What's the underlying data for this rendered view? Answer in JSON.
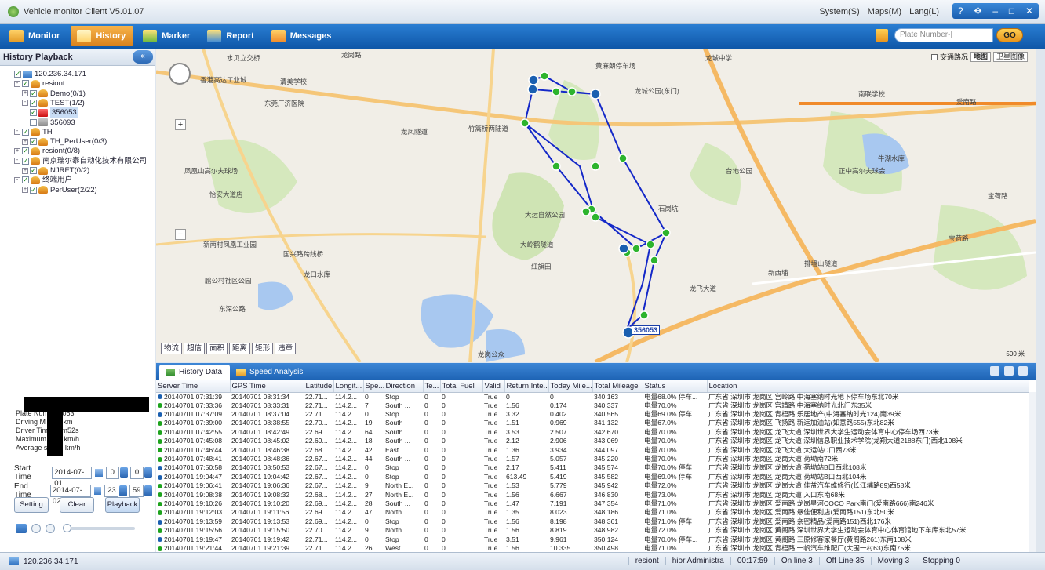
{
  "app": {
    "title": "Vehicle monitor Client V5.01.07",
    "menus": [
      "System(S)",
      "Maps(M)",
      "Lang(L)"
    ],
    "window_controls": [
      "?",
      "✥",
      "–",
      "□",
      "✕"
    ]
  },
  "toolbar": {
    "items": [
      {
        "label": "Monitor",
        "icon": "monitor-icon",
        "active": false
      },
      {
        "label": "History",
        "icon": "history-icon",
        "active": true
      },
      {
        "label": "Marker",
        "icon": "marker-icon",
        "active": false
      },
      {
        "label": "Report",
        "icon": "report-icon",
        "active": false
      },
      {
        "label": "Messages",
        "icon": "messages-icon",
        "active": false
      }
    ],
    "plate_placeholder": "Plate Number-|",
    "go_label": "GO"
  },
  "left": {
    "title": "History Playback",
    "close": "«",
    "tree": [
      {
        "label": "120.236.34.171",
        "icon": "pc",
        "checked": true,
        "exp": "",
        "level": 0
      },
      {
        "label": "resiont",
        "icon": "grp",
        "checked": true,
        "exp": "-",
        "level": 0
      },
      {
        "label": "Demo(0/1)",
        "icon": "grp",
        "checked": true,
        "exp": "+",
        "level": 1
      },
      {
        "label": "TEST(1/2)",
        "icon": "grp",
        "checked": true,
        "exp": "-",
        "level": 1
      },
      {
        "label": "356053",
        "icon": "car-on",
        "checked": true,
        "exp": "",
        "level": 2,
        "selected": true
      },
      {
        "label": "356093",
        "icon": "car-off",
        "checked": false,
        "exp": "",
        "level": 2
      },
      {
        "label": "TH",
        "icon": "grp",
        "checked": true,
        "exp": "-",
        "level": 0
      },
      {
        "label": "TH_PerUser(0/3)",
        "icon": "grp",
        "checked": true,
        "exp": "+",
        "level": 1
      },
      {
        "label": "resiont(0/8)",
        "icon": "grp",
        "checked": true,
        "exp": "+",
        "level": 0
      },
      {
        "label": "南京瑞尔泰自动化技术有限公司",
        "icon": "grp",
        "checked": true,
        "exp": "-",
        "level": 0
      },
      {
        "label": "NJRET(0/2)",
        "icon": "grp",
        "checked": true,
        "exp": "+",
        "level": 1
      },
      {
        "label": "终端用户",
        "icon": "grp",
        "checked": true,
        "exp": "-",
        "level": 0
      },
      {
        "label": "PerUser(2/22)",
        "icon": "grp",
        "checked": true,
        "exp": "+",
        "level": 1
      }
    ],
    "stats": [
      "Plate Num 356053",
      "Driving M 15.9 km",
      "Driver Tim 00hm52s",
      "Maximum 63.6 km/h",
      "Average s 18.1 km/h"
    ],
    "start_label": "Start Time",
    "start_date": "2014-07-01",
    "start_h": "0",
    "start_m": "0",
    "end_label": "End Time",
    "end_date": "2014-07-02",
    "end_h": "23",
    "end_m": "59",
    "buttons": [
      "Setting",
      "Clear",
      "Playback"
    ]
  },
  "map": {
    "traffic_label": "交通路况",
    "type_map": "地图",
    "type_sat": "卫星图像",
    "scale": "500 米",
    "marker_label": "356053",
    "tools": [
      "物流",
      "超信",
      "面积",
      "距离",
      "矩形",
      "违章"
    ],
    "labels": [
      {
        "t": "水贝立交桥"
      },
      {
        "t": "香港高达工业城"
      },
      {
        "t": "清美学校"
      },
      {
        "t": "东莞厂济医院"
      },
      {
        "t": "龙岗路"
      },
      {
        "t": "龙凤隧道"
      },
      {
        "t": "竹篙桥两陆道"
      },
      {
        "t": "黄麻朗停车场"
      },
      {
        "t": "龙城公园(东门)"
      },
      {
        "t": "龙城中学"
      },
      {
        "t": "南联学校"
      },
      {
        "t": "爱南路"
      },
      {
        "t": "牛湖水库"
      },
      {
        "t": "正中高尔夫球会"
      },
      {
        "t": "台地公园"
      },
      {
        "t": "大运自然公园"
      },
      {
        "t": "大岭鹤隧道"
      },
      {
        "t": "国兴路跨线桥"
      },
      {
        "t": "龙口水库"
      },
      {
        "t": "凤凰山高尔夫球场"
      },
      {
        "t": "怡安大道店"
      },
      {
        "t": "石岗坑"
      },
      {
        "t": "排墙山隧道"
      },
      {
        "t": "宝荷路"
      },
      {
        "t": "新南村凤凰工业园"
      },
      {
        "t": "鹏公村社区公园"
      },
      {
        "t": "东深公路"
      },
      {
        "t": "龙岗公众"
      },
      {
        "t": "新西埔"
      },
      {
        "t": "红旗田"
      },
      {
        "t": "宝荷路"
      },
      {
        "t": "龙飞大道"
      }
    ]
  },
  "tabs": [
    {
      "label": "History Data",
      "active": true
    },
    {
      "label": "Speed Analysis",
      "active": false
    }
  ],
  "grid": {
    "headers": [
      "Server Time",
      "GPS Time",
      "Latitude",
      "Longit...",
      "Spe...",
      "Direction",
      "Te...",
      "Total Fuel",
      "Valid",
      "Return Inte...",
      "Today Mile...",
      "Total Mileage",
      "Status",
      "Location"
    ],
    "rows": [
      {
        "st": "stop",
        "c": [
          "20140701 07:31:39",
          "20140701 08:31:34",
          "22.71...",
          "114.2...",
          "0",
          "Stop",
          "0",
          "0",
          "True",
          "0",
          "0",
          "340.163",
          "电量68.0% 停车...",
          "广东省 深圳市 龙岗区 宫岭路 中海塞纳时光地下停车场东北70米"
        ]
      },
      {
        "st": "run",
        "c": [
          "20140701 07:33:36",
          "20140701 08:33:31",
          "22.71...",
          "114.2...",
          "7",
          "South ...",
          "0",
          "0",
          "True",
          "1.56",
          "0.174",
          "340.337",
          "电量70.0%",
          "广东省 深圳市 龙岗区 宫靖路 中海塞纳时光北门东35米"
        ]
      },
      {
        "st": "stop",
        "c": [
          "20140701 07:37:09",
          "20140701 08:37:04",
          "22.71...",
          "114.2...",
          "0",
          "Stop",
          "0",
          "0",
          "True",
          "3.32",
          "0.402",
          "340.565",
          "电量69.0% 停车...",
          "广东省 深圳市 龙岗区 青梧路 乐居地产(中海塞纳时光124)南39米"
        ]
      },
      {
        "st": "run",
        "c": [
          "20140701 07:39:00",
          "20140701 08:38:55",
          "22.70...",
          "114.2...",
          "19",
          "South",
          "0",
          "0",
          "True",
          "1.51",
          "0.969",
          "341.132",
          "电量67.0%",
          "广东省 深圳市 龙岗区 飞扬路 新运加油站(如意路555)东北82米"
        ]
      },
      {
        "st": "run",
        "c": [
          "20140701 07:42:55",
          "20140701 08:42:49",
          "22.69...",
          "114.2...",
          "64",
          "South ...",
          "0",
          "0",
          "True",
          "3.53",
          "2.507",
          "342.670",
          "电量70.0%",
          "广东省 深圳市 龙岗区 龙飞大道 深圳世界大学生运动会体育中心停车场西73米"
        ]
      },
      {
        "st": "run",
        "c": [
          "20140701 07:45:08",
          "20140701 08:45:02",
          "22.69...",
          "114.2...",
          "18",
          "South ...",
          "0",
          "0",
          "True",
          "2.12",
          "2.906",
          "343.069",
          "电量70.0%",
          "广东省 深圳市 龙岗区 龙飞大道 深圳信息职业技术学院(龙翔大道2188东门)西北198米"
        ]
      },
      {
        "st": "run",
        "c": [
          "20140701 07:46:44",
          "20140701 08:46:38",
          "22.68...",
          "114.2...",
          "42",
          "East",
          "0",
          "0",
          "True",
          "1.36",
          "3.934",
          "344.097",
          "电量70.0%",
          "广东省 深圳市 龙岗区 龙飞大道 大运站C口西73米"
        ]
      },
      {
        "st": "run",
        "c": [
          "20140701 07:48:41",
          "20140701 08:48:36",
          "22.67...",
          "114.2...",
          "44",
          "South ...",
          "0",
          "0",
          "True",
          "1.57",
          "5.057",
          "345.220",
          "电量70.0%",
          "广东省 深圳市 龙岗区 龙岗大道 荷坳南72米"
        ]
      },
      {
        "st": "stop",
        "c": [
          "20140701 07:50:58",
          "20140701 08:50:53",
          "22.67...",
          "114.2...",
          "0",
          "Stop",
          "0",
          "0",
          "True",
          "2.17",
          "5.411",
          "345.574",
          "电量70.0% 停车",
          "广东省 深圳市 龙岗区 龙岗大道 荷坳站B口西北108米"
        ]
      },
      {
        "st": "stop",
        "c": [
          "20140701 19:04:47",
          "20140701 19:04:42",
          "22.67...",
          "114.2...",
          "0",
          "Stop",
          "0",
          "0",
          "True",
          "613.49",
          "5.419",
          "345.582",
          "电量69.0% 停车",
          "广东省 深圳市 龙岗区 龙岗大道 荷坳站B口西北104米"
        ]
      },
      {
        "st": "run",
        "c": [
          "20140701 19:06:41",
          "20140701 19:06:36",
          "22.67...",
          "114.2...",
          "9",
          "North E...",
          "0",
          "0",
          "True",
          "1.53",
          "5.779",
          "345.942",
          "电量72.0%",
          "广东省 深圳市 龙岗区 龙岗大道 佳益汽车维修行(长江埔路89)西58米"
        ]
      },
      {
        "st": "run",
        "c": [
          "20140701 19:08:38",
          "20140701 19:08:32",
          "22.68...",
          "114.2...",
          "27",
          "North E...",
          "0",
          "0",
          "True",
          "1.56",
          "6.667",
          "346.830",
          "电量73.0%",
          "广东省 深圳市 龙岗区 龙岗大道 入口东南68米"
        ]
      },
      {
        "st": "run",
        "c": [
          "20140701 19:10:26",
          "20140701 19:10:20",
          "22.69...",
          "114.2...",
          "28",
          "South ...",
          "0",
          "0",
          "True",
          "1.47",
          "7.191",
          "347.354",
          "电量71.0%",
          "广东省 深圳市 龙岗区 爱南路 龙岗星河COCO Park南门(爱南路666)南246米"
        ]
      },
      {
        "st": "run",
        "c": [
          "20140701 19:12:03",
          "20140701 19:11:56",
          "22.69...",
          "114.2...",
          "47",
          "North ...",
          "0",
          "0",
          "True",
          "1.35",
          "8.023",
          "348.186",
          "电量71.0%",
          "广东省 深圳市 龙岗区 爱南路 悬佳便利店(爱南路151)东北50米"
        ]
      },
      {
        "st": "stop",
        "c": [
          "20140701 19:13:59",
          "20140701 19:13:53",
          "22.69...",
          "114.2...",
          "0",
          "Stop",
          "0",
          "0",
          "True",
          "1.56",
          "8.198",
          "348.361",
          "电量71.0% 停车",
          "广东省 深圳市 龙岗区 爱南路 亲密精品(爱南路151)西北176米"
        ]
      },
      {
        "st": "run",
        "c": [
          "20140701 19:15:56",
          "20140701 19:15:50",
          "22.70...",
          "114.2...",
          "9",
          "North",
          "0",
          "0",
          "True",
          "1.56",
          "8.819",
          "348.982",
          "电量72.0%",
          "广东省 深圳市 龙岗区 黄阁路 深圳世界大学生运动会体育中心体育馆地下车库东北57米"
        ]
      },
      {
        "st": "stop",
        "c": [
          "20140701 19:19:47",
          "20140701 19:19:42",
          "22.71...",
          "114.2...",
          "0",
          "Stop",
          "0",
          "0",
          "True",
          "3.51",
          "9.961",
          "350.124",
          "电量70.0% 停车...",
          "广东省 深圳市 龙岗区 黄阁路 三原修客家餐厅(黄阁路261)东南108米"
        ]
      },
      {
        "st": "run",
        "c": [
          "20140701 19:21:44",
          "20140701 19:21:39",
          "22.71...",
          "114.2...",
          "26",
          "West",
          "0",
          "0",
          "True",
          "1.56",
          "10.335",
          "350.498",
          "电量71.0%",
          "广东省 深圳市 龙岗区 青梧路 一帆汽车维配厂(大围一村63)东南75米"
        ]
      }
    ]
  },
  "status": {
    "server": "120.236.34.171",
    "group": "resiont",
    "user": "hior Administra",
    "time": "00:17:59",
    "online": "On line 3",
    "offline": "Off Line 35",
    "moving": "Moving 3",
    "stopping": "Stopping 0"
  },
  "colors": {
    "toolbar": "#1b6cc2",
    "active_tab": "#e8951c",
    "route": "#1428c8",
    "point": "#2db42d"
  }
}
